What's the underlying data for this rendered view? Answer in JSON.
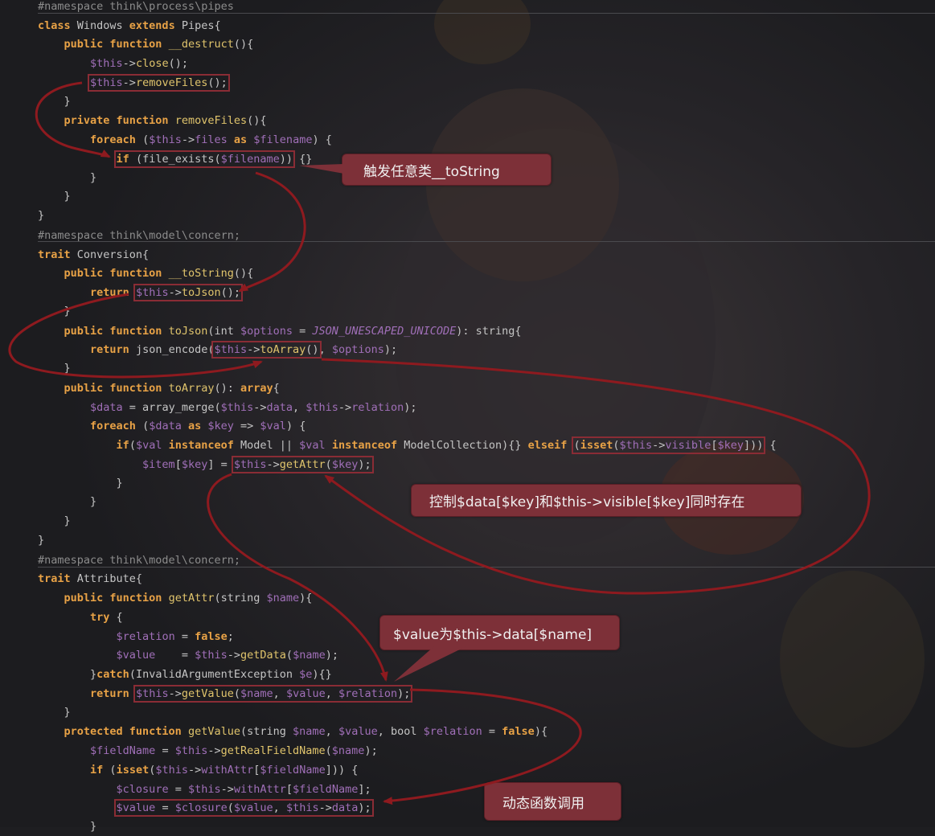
{
  "code_lines": [
    "#namespace think\\process\\pipes",
    "class Windows extends Pipes{",
    "public function __destruct(){",
    "$this->close();",
    "$this->removeFiles();",
    "}",
    "private function removeFiles(){",
    "foreach ($this->files as $filename) {",
    "if (file_exists($filename)) {}",
    "}",
    "}",
    "}",
    "#namespace think\\model\\concern;",
    "trait Conversion{",
    "public function __toString(){",
    "return $this->toJson();",
    "}",
    "public function toJson(int $options = JSON_UNESCAPED_UNICODE): string{",
    "return json_encode($this->toArray(), $options);",
    "}",
    "public function toArray(): array{",
    "$data = array_merge($this->data, $this->relation);",
    "foreach ($data as $key => $val) {",
    "if($val instanceof Model || $val instanceof ModelCollection){} elseif (isset($this->visible[$key])) {",
    "$item[$key] = $this->getAttr($key);",
    "}",
    "}",
    "}",
    "}",
    "#namespace think\\model\\concern;",
    "trait Attribute{",
    "public function getAttr(string $name){",
    "try {",
    "$relation = false;",
    "$value    = $this->getData($name);",
    "}catch(InvalidArgumentException $e){}",
    "return $this->getValue($name, $value, $relation);",
    "}",
    "protected function getValue(string $name, $value, bool $relation = false){",
    "$fieldName = $this->getRealFieldName($name);",
    "if (isset($this->withAttr[$fieldName])) {",
    "$closure = $this->withAttr[$fieldName];",
    "$value = $closure($value, $this->data);",
    "}"
  ],
  "callouts": {
    "tostring": "触发任意类__toString",
    "visible": "控制$data[$key]和$this->visible[$key]同时存在",
    "value": "$value为$this->data[$name]",
    "dynamic": "动态函数调用"
  },
  "colors": {
    "background": "#1e1e21",
    "keyword": "#e8a246",
    "function": "#e0c46c",
    "variable": "#a06fb8",
    "comment": "#8c8c8c",
    "highlight_box": "#8a2c35",
    "arrow": "#8e1a1f",
    "callout_bg": "#7d3038"
  }
}
